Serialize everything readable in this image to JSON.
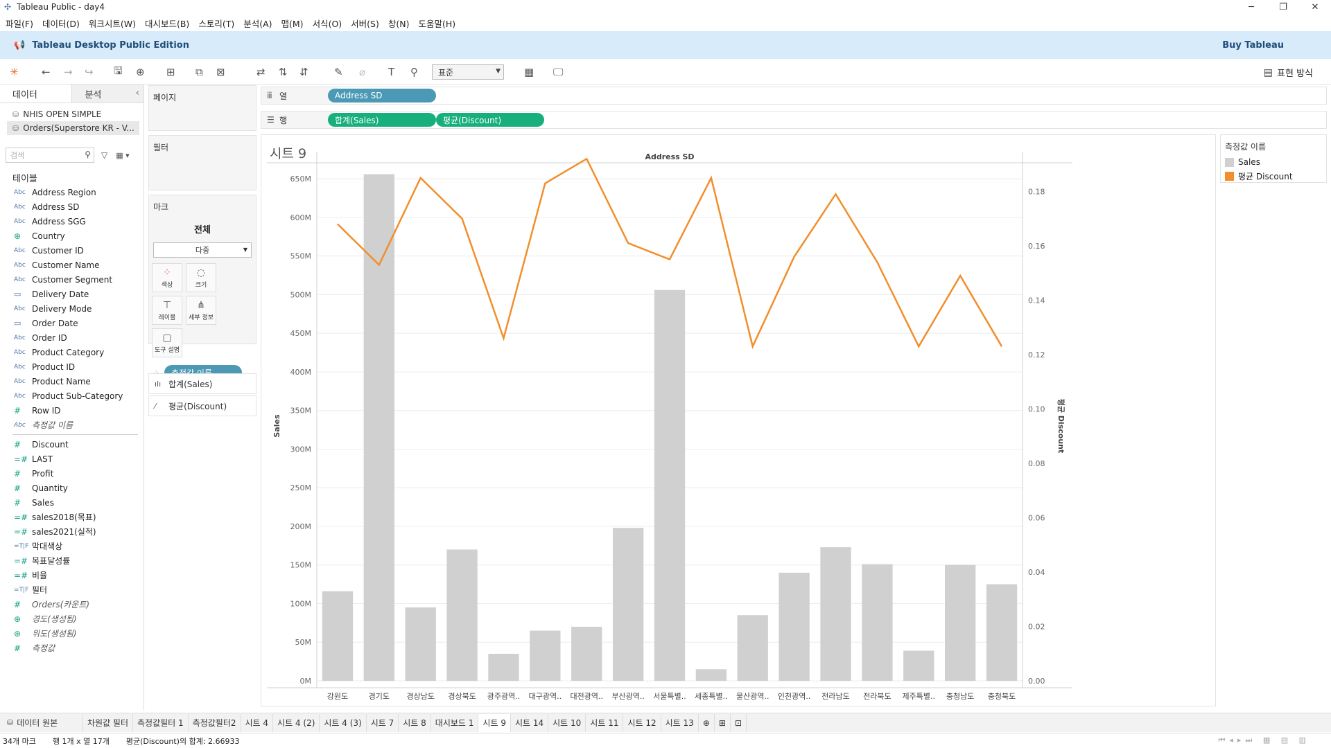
{
  "window": {
    "title": "Tableau Public - day4",
    "controls": [
      "─",
      "❐",
      "✕"
    ]
  },
  "menu": [
    "파일(F)",
    "데이터(D)",
    "워크시트(W)",
    "대시보드(B)",
    "스토리(T)",
    "분석(A)",
    "맵(M)",
    "서식(O)",
    "서버(S)",
    "창(N)",
    "도움말(H)"
  ],
  "banner": {
    "edition": "Tableau Desktop Public Edition",
    "buy": "Buy Tableau"
  },
  "toolbar": {
    "fit_value": "표준",
    "show_me": "표현 방식"
  },
  "datapane": {
    "tab_data": "데이터",
    "tab_analysis": "분석",
    "sources": [
      "NHIS OPEN SIMPLE",
      "Orders(Superstore KR - V..."
    ],
    "search_placeholder": "검색",
    "tables_label": "테이블",
    "dimensions": [
      {
        "type": "Abc",
        "name": "Address Region",
        "kind": "dim"
      },
      {
        "type": "Abc",
        "name": "Address SD",
        "kind": "dim"
      },
      {
        "type": "Abc",
        "name": "Address SGG",
        "kind": "dim"
      },
      {
        "type": "⊕",
        "name": "Country",
        "kind": "geo"
      },
      {
        "type": "Abc",
        "name": "Customer ID",
        "kind": "dim"
      },
      {
        "type": "Abc",
        "name": "Customer Name",
        "kind": "dim"
      },
      {
        "type": "Abc",
        "name": "Customer Segment",
        "kind": "dim"
      },
      {
        "type": "▭",
        "name": "Delivery Date",
        "kind": "date"
      },
      {
        "type": "Abc",
        "name": "Delivery Mode",
        "kind": "dim"
      },
      {
        "type": "▭",
        "name": "Order Date",
        "kind": "date"
      },
      {
        "type": "Abc",
        "name": "Order ID",
        "kind": "dim"
      },
      {
        "type": "Abc",
        "name": "Product Category",
        "kind": "dim"
      },
      {
        "type": "Abc",
        "name": "Product ID",
        "kind": "dim"
      },
      {
        "type": "Abc",
        "name": "Product Name",
        "kind": "dim"
      },
      {
        "type": "Abc",
        "name": "Product Sub-Category",
        "kind": "dim"
      },
      {
        "type": "#",
        "name": "Row ID",
        "kind": "mea"
      },
      {
        "type": "Abc",
        "name": "측정값 이름",
        "kind": "dim",
        "italic": true
      }
    ],
    "measures": [
      {
        "type": "#",
        "name": "Discount",
        "kind": "mea"
      },
      {
        "type": "=#",
        "name": "LAST",
        "kind": "mea"
      },
      {
        "type": "#",
        "name": "Profit",
        "kind": "mea"
      },
      {
        "type": "#",
        "name": "Quantity",
        "kind": "mea"
      },
      {
        "type": "#",
        "name": "Sales",
        "kind": "mea"
      },
      {
        "type": "=#",
        "name": "sales2018(목표)",
        "kind": "mea"
      },
      {
        "type": "=#",
        "name": "sales2021(실적)",
        "kind": "mea"
      },
      {
        "type": "=T|F",
        "name": "막대색상",
        "kind": "dim"
      },
      {
        "type": "=#",
        "name": "목표달성률",
        "kind": "mea"
      },
      {
        "type": "=#",
        "name": "비율",
        "kind": "mea"
      },
      {
        "type": "=T|F",
        "name": "필터",
        "kind": "dim"
      },
      {
        "type": "#",
        "name": "Orders(카운트)",
        "kind": "mea",
        "italic": true
      },
      {
        "type": "⊕",
        "name": "경도(생성됨)",
        "kind": "geo",
        "italic": true
      },
      {
        "type": "⊕",
        "name": "위도(생성됨)",
        "kind": "geo",
        "italic": true
      },
      {
        "type": "#",
        "name": "측정값",
        "kind": "mea",
        "italic": true
      }
    ]
  },
  "cards": {
    "pages": "페이지",
    "filters": "필터",
    "marks": "마크",
    "marks_all": "전체",
    "marks_type": "다중",
    "buttons": [
      {
        "icon": "●●",
        "label": "색상"
      },
      {
        "icon": "◌",
        "label": "크기"
      },
      {
        "icon": "T",
        "label": "레이블"
      },
      {
        "icon": "⋔",
        "label": "세부 정보"
      },
      {
        "icon": "▢",
        "label": "도구 설명"
      }
    ],
    "color_pill": "측정값 이름",
    "measure_sales": "합계(Sales)",
    "measure_discount": "평균(Discount)"
  },
  "shelves": {
    "columns_label": "열",
    "rows_label": "행",
    "columns_pill": "Address SD",
    "rows_pills": [
      "합계(Sales)",
      "평균(Discount)"
    ]
  },
  "sheet": {
    "title": "시트 9"
  },
  "legend": {
    "title": "측정값 이름",
    "items": [
      {
        "label": "Sales",
        "color": "#d0d0d0"
      },
      {
        "label": "평균 Discount",
        "color": "#f28e2b"
      }
    ]
  },
  "chart_data": {
    "type": "bar",
    "title": "Address SD",
    "categories": [
      "강원도",
      "경기도",
      "경상남도",
      "경상북도",
      "광주광역..",
      "대구광역..",
      "대전광역..",
      "부산광역..",
      "서울특별..",
      "세종특별..",
      "울산광역..",
      "인천광역..",
      "전라남도",
      "전라북도",
      "제주특별..",
      "충청남도",
      "충청북도"
    ],
    "series": [
      {
        "name": "Sales",
        "type": "bar",
        "color": "#d0d0d0",
        "axis": "left",
        "values": [
          116,
          656,
          95,
          170,
          35,
          65,
          70,
          198,
          506,
          15,
          85,
          140,
          173,
          151,
          39,
          150,
          125
        ]
      },
      {
        "name": "평균 Discount",
        "type": "line",
        "color": "#f28e2b",
        "axis": "right",
        "values": [
          0.168,
          0.153,
          0.185,
          0.17,
          0.126,
          0.183,
          0.192,
          0.161,
          0.155,
          0.185,
          0.123,
          0.156,
          0.179,
          0.154,
          0.123,
          0.149,
          0.123
        ]
      }
    ],
    "ylabel": "Sales",
    "y2label": "평균 Discount",
    "ylim": [
      0,
      660
    ],
    "y2lim": [
      0,
      0.1875
    ],
    "yticks": [
      "0M",
      "50M",
      "100M",
      "150M",
      "200M",
      "250M",
      "300M",
      "350M",
      "400M",
      "450M",
      "500M",
      "550M",
      "600M",
      "650M"
    ],
    "y2ticks": [
      "0.00",
      "0.02",
      "0.04",
      "0.06",
      "0.08",
      "0.10",
      "0.12",
      "0.14",
      "0.16",
      "0.18"
    ]
  },
  "bottom_tabs": {
    "datasource": "데이터 원본",
    "sheets": [
      "차원값 필터",
      "측정값필터 1",
      "측정값필터2",
      "시트 4",
      "시트 4 (2)",
      "시트 4 (3)",
      "시트 7",
      "시트 8",
      "대시보드 1",
      "시트 9",
      "시트 14",
      "시트 10",
      "시트 11",
      "시트 12",
      "시트 13"
    ],
    "active": "시트 9"
  },
  "status": {
    "marks": "34개 마크",
    "rows_cols": "행 1개 x 열 17개",
    "sum": "평균(Discount)의 합계: 2.66933"
  }
}
